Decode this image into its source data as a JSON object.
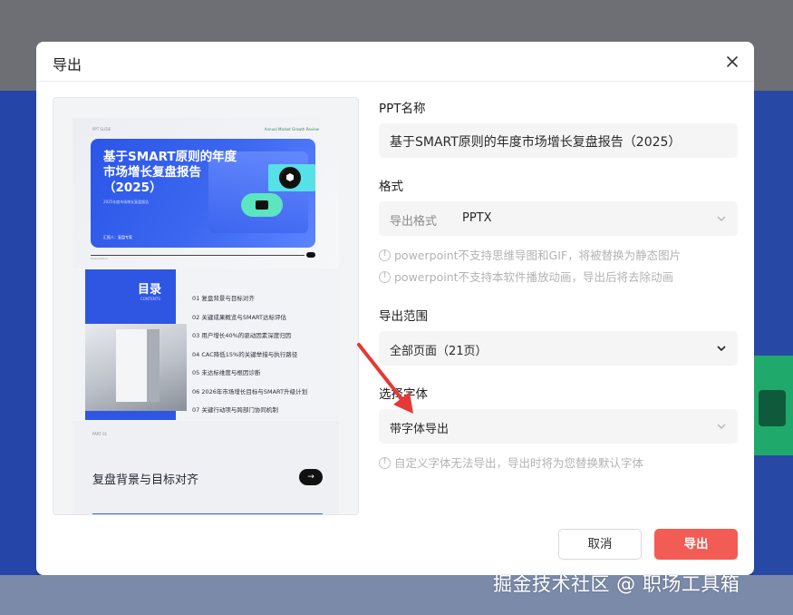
{
  "modal": {
    "title": "导出"
  },
  "preview": {
    "slide1": {
      "header_left": "PPT SLIDE",
      "header_right": "Annual Market Growth Review",
      "title": "基于SMART原则的年度市场增长复盘报告（2025）",
      "subtitle": "2025年度市场增长复盘报告",
      "author": "汇报人：复盘专家",
      "footer": "Presentation"
    },
    "slide2": {
      "heading": "目录",
      "subheading": "CONTENTS",
      "items": [
        "01  复盘背景与目标对齐",
        "02  关键成果概览与SMART达标评估",
        "03  用户增长40%的驱动因素深度归因",
        "04  CAC降低15%的关键举措与执行路径",
        "05  未达标维度与根因诊断",
        "06  2026年市场增长目标与SMART升级计划",
        "07  关键行动项与跨部门协同机制"
      ]
    },
    "slide3": {
      "tag": "PART 01",
      "title": "复盘背景与目标对齐",
      "button": "→"
    }
  },
  "form": {
    "name_label": "PPT名称",
    "name_value": "基于SMART原则的年度市场增长复盘报告（2025）",
    "format_label": "格式",
    "format_prefix": "导出格式",
    "format_value": "PPTX",
    "format_hints": [
      "powerpoint不支持思维导图和GIF，将被替换为静态图片",
      "powerpoint不支持本软件播放动画，导出后将去除动画"
    ],
    "range_label": "导出范围",
    "range_value": "全部页面（21页）",
    "font_label": "选择字体",
    "font_value": "带字体导出",
    "font_hint": "自定义字体无法导出，导出时将为您替换默认字体"
  },
  "actions": {
    "cancel": "取消",
    "export": "导出"
  },
  "watermark": "掘金技术社区 @ 职场工具箱",
  "colors": {
    "accent": "#f25c54",
    "slide_blue": "#2f56e3",
    "arrow": "#e53935"
  }
}
